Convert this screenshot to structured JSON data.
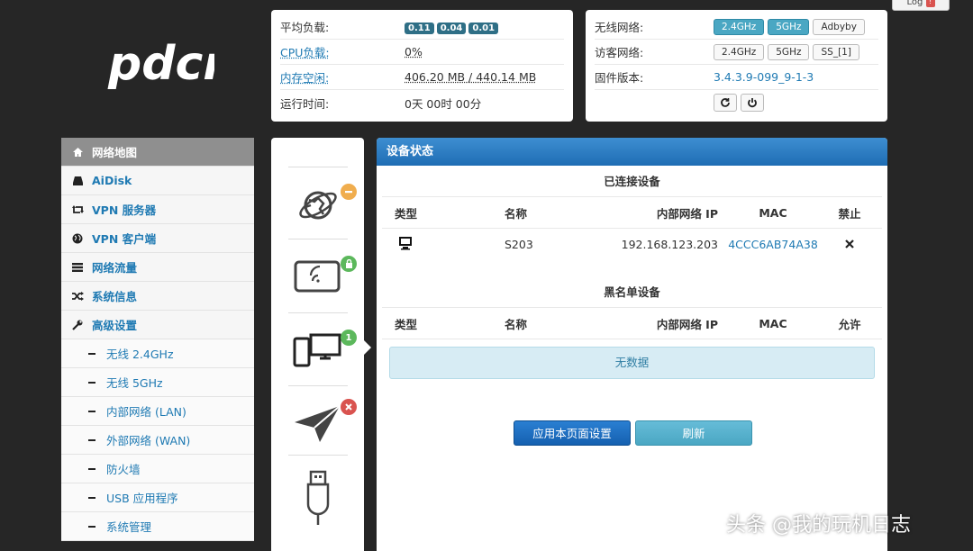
{
  "logo_text": "pdcn",
  "logout": {
    "label": "Log"
  },
  "status": {
    "load": {
      "label": "平均负载:",
      "values": [
        "0.11",
        "0.04",
        "0.01"
      ]
    },
    "cpu": {
      "label": "CPU负载:",
      "value": "0%"
    },
    "mem": {
      "label": "内存空闲:",
      "value": "406.20 MB / 440.14 MB"
    },
    "uptime": {
      "label": "运行时间:",
      "value": "0天 00时 00分"
    }
  },
  "network": {
    "wireless": {
      "label": "无线网络:",
      "buttons": [
        "2.4GHz",
        "5GHz",
        "Adbyby"
      ]
    },
    "guest": {
      "label": "访客网络:",
      "buttons": [
        "2.4GHz",
        "5GHz",
        "SS_[1]"
      ]
    },
    "firmware": {
      "label": "固件版本:",
      "value": "3.4.3.9-099_9-1-3"
    }
  },
  "sidebar": {
    "items": [
      {
        "label": "网络地图",
        "icon": "home-icon"
      },
      {
        "label": "AiDisk",
        "icon": "disk-icon"
      },
      {
        "label": "VPN 服务器",
        "icon": "retweet-icon"
      },
      {
        "label": "VPN 客户端",
        "icon": "globe-icon"
      },
      {
        "label": "网络流量",
        "icon": "list-icon"
      },
      {
        "label": "系统信息",
        "icon": "shuffle-icon"
      },
      {
        "label": "高级设置",
        "icon": "wrench-icon"
      }
    ],
    "subitems": [
      "无线 2.4GHz",
      "无线 5GHz",
      "内部网络 (LAN)",
      "外部网络 (WAN)",
      "防火墙",
      "USB 应用程序",
      "系统管理"
    ]
  },
  "status_icons": {
    "device_count": "1"
  },
  "main": {
    "title": "设备状态",
    "connected": {
      "title": "已连接设备",
      "headers": [
        "类型",
        "名称",
        "内部网络 IP",
        "MAC",
        "禁止"
      ],
      "rows": [
        {
          "name": "S203",
          "ip": "192.168.123.203",
          "mac": "4CCC6AB74A38"
        }
      ]
    },
    "blacklist": {
      "title": "黑名单设备",
      "headers": [
        "类型",
        "名称",
        "内部网络 IP",
        "MAC",
        "允许"
      ],
      "empty": "无数据"
    },
    "apply_button": "应用本页面设置",
    "refresh_button": "刷新"
  },
  "watermark": "头条 @我的玩机日志"
}
